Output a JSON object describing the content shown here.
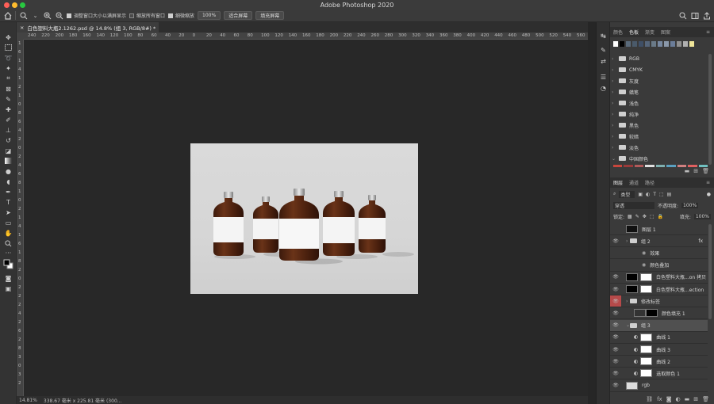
{
  "window": {
    "title": "Adobe Photoshop 2020"
  },
  "options_bar": {
    "checks": [
      {
        "label": "调整窗口大小以满屏显示",
        "checked": true
      },
      {
        "label": "缩放所有窗口",
        "checked": false
      },
      {
        "label": "细微缩放",
        "checked": true
      }
    ],
    "zoom_value": "100%",
    "fit_screen_label": "适合屏幕",
    "fill_screen_label": "填充屏幕"
  },
  "document": {
    "tab_label": "白色塑料大瓶2.1262.psd @ 14.8% (组 3, RGB/8#) *",
    "close_glyph": "×"
  },
  "rulers": {
    "horizontal": [
      "240",
      "220",
      "200",
      "180",
      "160",
      "140",
      "120",
      "100",
      "80",
      "60",
      "40",
      "20",
      "0",
      "20",
      "40",
      "60",
      "80",
      "100",
      "120",
      "140",
      "160",
      "180",
      "200",
      "220",
      "240",
      "260",
      "280",
      "300",
      "320",
      "340",
      "360",
      "380",
      "400",
      "420",
      "440",
      "460",
      "480",
      "500",
      "520",
      "540",
      "560"
    ],
    "vertical": [
      "1",
      "6",
      "1",
      "4",
      "1",
      "2",
      "1",
      "0",
      "8",
      "6",
      "4",
      "2",
      "0",
      "2",
      "4",
      "6",
      "8",
      "1",
      "0",
      "2",
      "1",
      "4",
      "1",
      "6",
      "1",
      "8",
      "2",
      "0",
      "2",
      "2",
      "2",
      "4",
      "2",
      "6",
      "2",
      "8",
      "3",
      "0",
      "3",
      "2"
    ]
  },
  "status": {
    "zoom": "14.81%",
    "size": "338.67 毫米 x 225.81 毫米 (300..."
  },
  "swatches_panel": {
    "tabs": [
      "颜色",
      "色板",
      "渐变",
      "图案"
    ],
    "active_tab": "色板",
    "top_swatches": [
      "#ffffff",
      "#000000",
      "#5a6a7a",
      "#4a5a6a",
      "#3f4f66",
      "#55657a",
      "#6a7a88",
      "#7788a0",
      "#8a98aa",
      "#6b7d99",
      "#909090",
      "#b0b0b0",
      "#f0e69a"
    ],
    "groups": [
      "RGB",
      "CMYK",
      "灰度",
      "蜡笔",
      "浅色",
      "纯净",
      "黑色",
      "较暗",
      "淡色",
      "中国颜色"
    ],
    "china_colors": [
      "#c8463c",
      "#9a3a3a",
      "#b25a5a",
      "#e0e0e0",
      "#7fb0b0",
      "#5aa0c0",
      "#d08080",
      "#e06060",
      "#70c0c0"
    ]
  },
  "layers_panel": {
    "tabs": [
      "图层",
      "通道",
      "路径"
    ],
    "active_tab": "图层",
    "filter_label": "类型",
    "blend_mode": "穿透",
    "opacity_label": "不透明度:",
    "opacity_value": "100%",
    "lock_label": "锁定:",
    "fill_label": "填充:",
    "fill_value": "100%",
    "layers": [
      {
        "name": "图层 1",
        "kind": "pixel"
      },
      {
        "name": "组 2",
        "kind": "group",
        "fx": "fx"
      },
      {
        "name": "效果",
        "kind": "effect"
      },
      {
        "name": "颜色叠加",
        "kind": "effect"
      },
      {
        "name": "白色塑料大瓶...on 拷贝",
        "kind": "smart"
      },
      {
        "name": "白色塑料大瓶...ection",
        "kind": "smart"
      },
      {
        "name": "修改标签",
        "kind": "group-red"
      },
      {
        "name": "颜色填充 1",
        "kind": "fill"
      },
      {
        "name": "组 3",
        "kind": "group-selected"
      },
      {
        "name": "曲线 1",
        "kind": "adjust"
      },
      {
        "name": "曲线 3",
        "kind": "adjust"
      },
      {
        "name": "曲线 2",
        "kind": "adjust"
      },
      {
        "name": "选取颜色 1",
        "kind": "adjust"
      },
      {
        "name": "rgb",
        "kind": "pixel"
      }
    ]
  },
  "colors": {
    "accent": "#31a8ff",
    "red_layer": "#b64a4a",
    "bottle": "#5a2814",
    "cap": "#bdbdbd",
    "label": "#ffffff"
  }
}
